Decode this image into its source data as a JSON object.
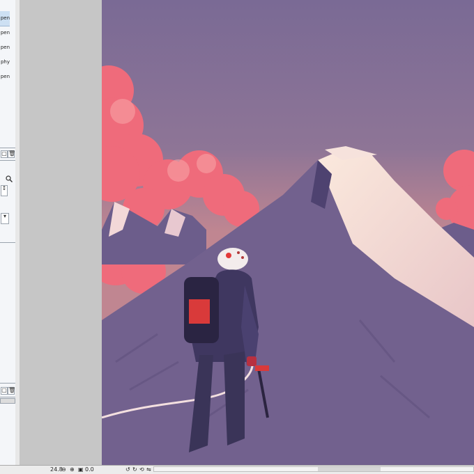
{
  "layers_panel": {
    "layers": [
      {
        "label": "pen",
        "selected": true
      },
      {
        "label": "pen",
        "selected": false
      },
      {
        "label": "pen",
        "selected": false
      },
      {
        "label": "phy",
        "selected": false
      },
      {
        "label": "pen",
        "selected": false
      }
    ]
  },
  "status": {
    "zoom": "24.8",
    "angle": "0.0"
  },
  "icons": {
    "zoom_in": "zoom-in-icon",
    "zoom_out": "zoom-out-icon",
    "fit": "fit-icon",
    "rotate_left": "rotate-left-icon",
    "rotate_right": "rotate-right-icon",
    "reset": "reset-icon",
    "flip": "flip-icon",
    "color": "color-wheel-icon"
  },
  "colors": {
    "sky_top": "#7a6a95",
    "sky_bottom": "#c08691",
    "cloud": "#f06c7c",
    "snow": "#f8e3d8",
    "mountain": "#72618e",
    "accent_red": "#e23a3a"
  }
}
